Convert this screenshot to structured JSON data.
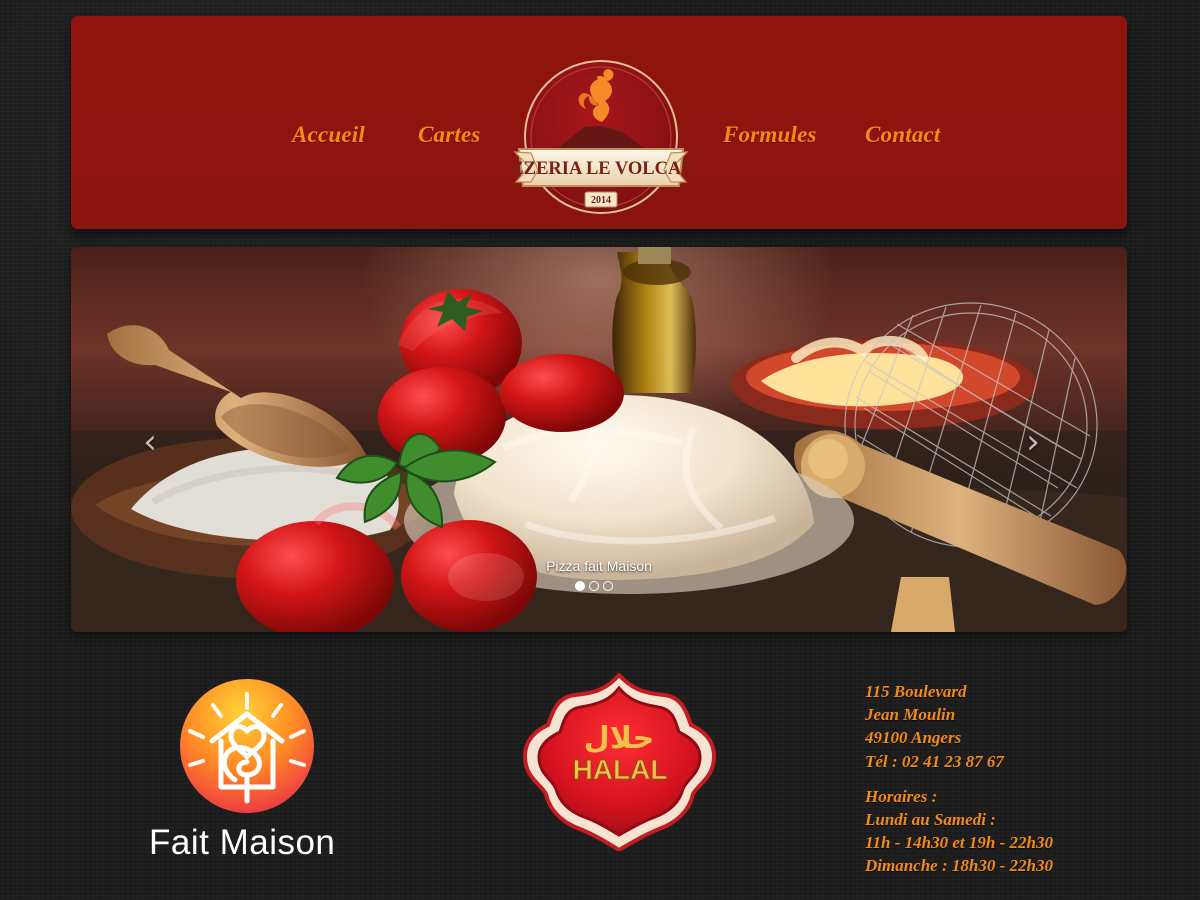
{
  "navigation": {
    "items": [
      "Accueil",
      "Cartes",
      "Formules",
      "Contact"
    ]
  },
  "logo": {
    "name": "PIZZERIA LE VOLCANO",
    "year": "2014"
  },
  "slider": {
    "caption": "Pizza fait Maison",
    "indicator_count": 3,
    "active_index": 0,
    "prev_icon": "chevron-left-icon",
    "next_icon": "chevron-right-icon"
  },
  "badges": {
    "homemade": "Fait Maison",
    "halal_latin": "HALAL",
    "halal_arabic": "حلال"
  },
  "contact": {
    "address_line_1": "115 Boulevard",
    "address_line_2": "Jean Moulin",
    "address_line_3": "49100 Angers",
    "phone": "Tél : 02 41 23 87 67",
    "hours_title": "Horaires :",
    "weekday_title": "Lundi au Samedi :",
    "weekday_hours": "11h - 14h30 et 19h - 22h30",
    "sunday_hours": "Dimanche : 18h30 - 22h30"
  },
  "colors": {
    "header_red": "#8f140f",
    "link_orange": "#f28a1a",
    "background": "#1d1d1d",
    "halal_red": "#d3121f"
  }
}
